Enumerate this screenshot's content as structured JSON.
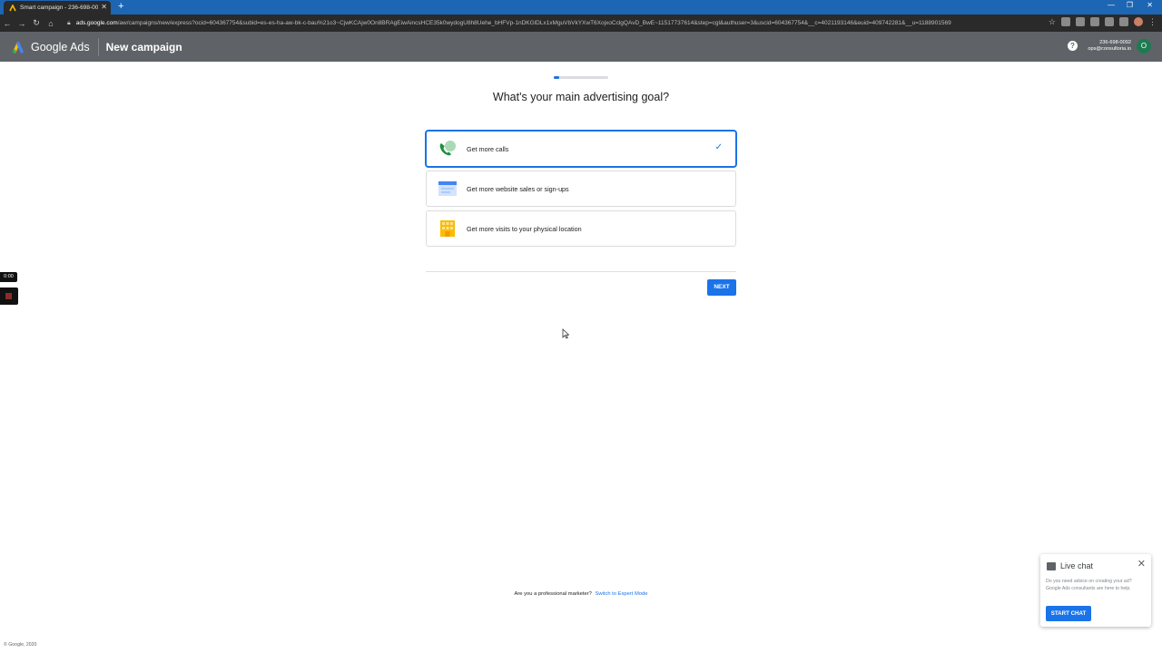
{
  "browser": {
    "tab_title": "Smart campaign - 236-698-0092",
    "url_host": "ads.google.com",
    "url_path": "/aw/campaigns/new/express?ocid=604367754&subid=es-es-ha-aw-bk-c-bau%21o3~CjwKCAjw0On8BRAgEiwAincsHCE35k0wydogU8h8Uehe_bHFVp-1nDKGlDLx1xMguVbVkYXwT6XojxoCclgQAvD_BwE~11517737614&step=cgl&authuser=3&uscid=604367754&__c=4021193146&euid=409742281&__u=1188901569"
  },
  "header": {
    "brand": "Google Ads",
    "page_title": "New campaign",
    "account_phone": "236-698-0092",
    "account_email": "ops@consultoria.io",
    "avatar_initial": "O"
  },
  "wizard": {
    "progress": 0.1,
    "question": "What's your main advertising goal?",
    "options": [
      {
        "label": "Get more calls",
        "selected": true
      },
      {
        "label": "Get more website sales or sign-ups",
        "selected": false
      },
      {
        "label": "Get more visits to your physical location",
        "selected": false
      }
    ],
    "next_label": "NEXT"
  },
  "recorder": {
    "timer": "0:00"
  },
  "footer": {
    "pro_text": "Are you a professional marketer?",
    "expert_link": "Switch to Expert Mode",
    "copyright": "© Google, 2020"
  },
  "chat": {
    "title": "Live chat",
    "body": "Do you need advice on creating your ad? Google Ads consultants are here to help.",
    "button": "START CHAT"
  },
  "colors": {
    "accent": "#1a73e8",
    "appbar": "#5f6368"
  }
}
